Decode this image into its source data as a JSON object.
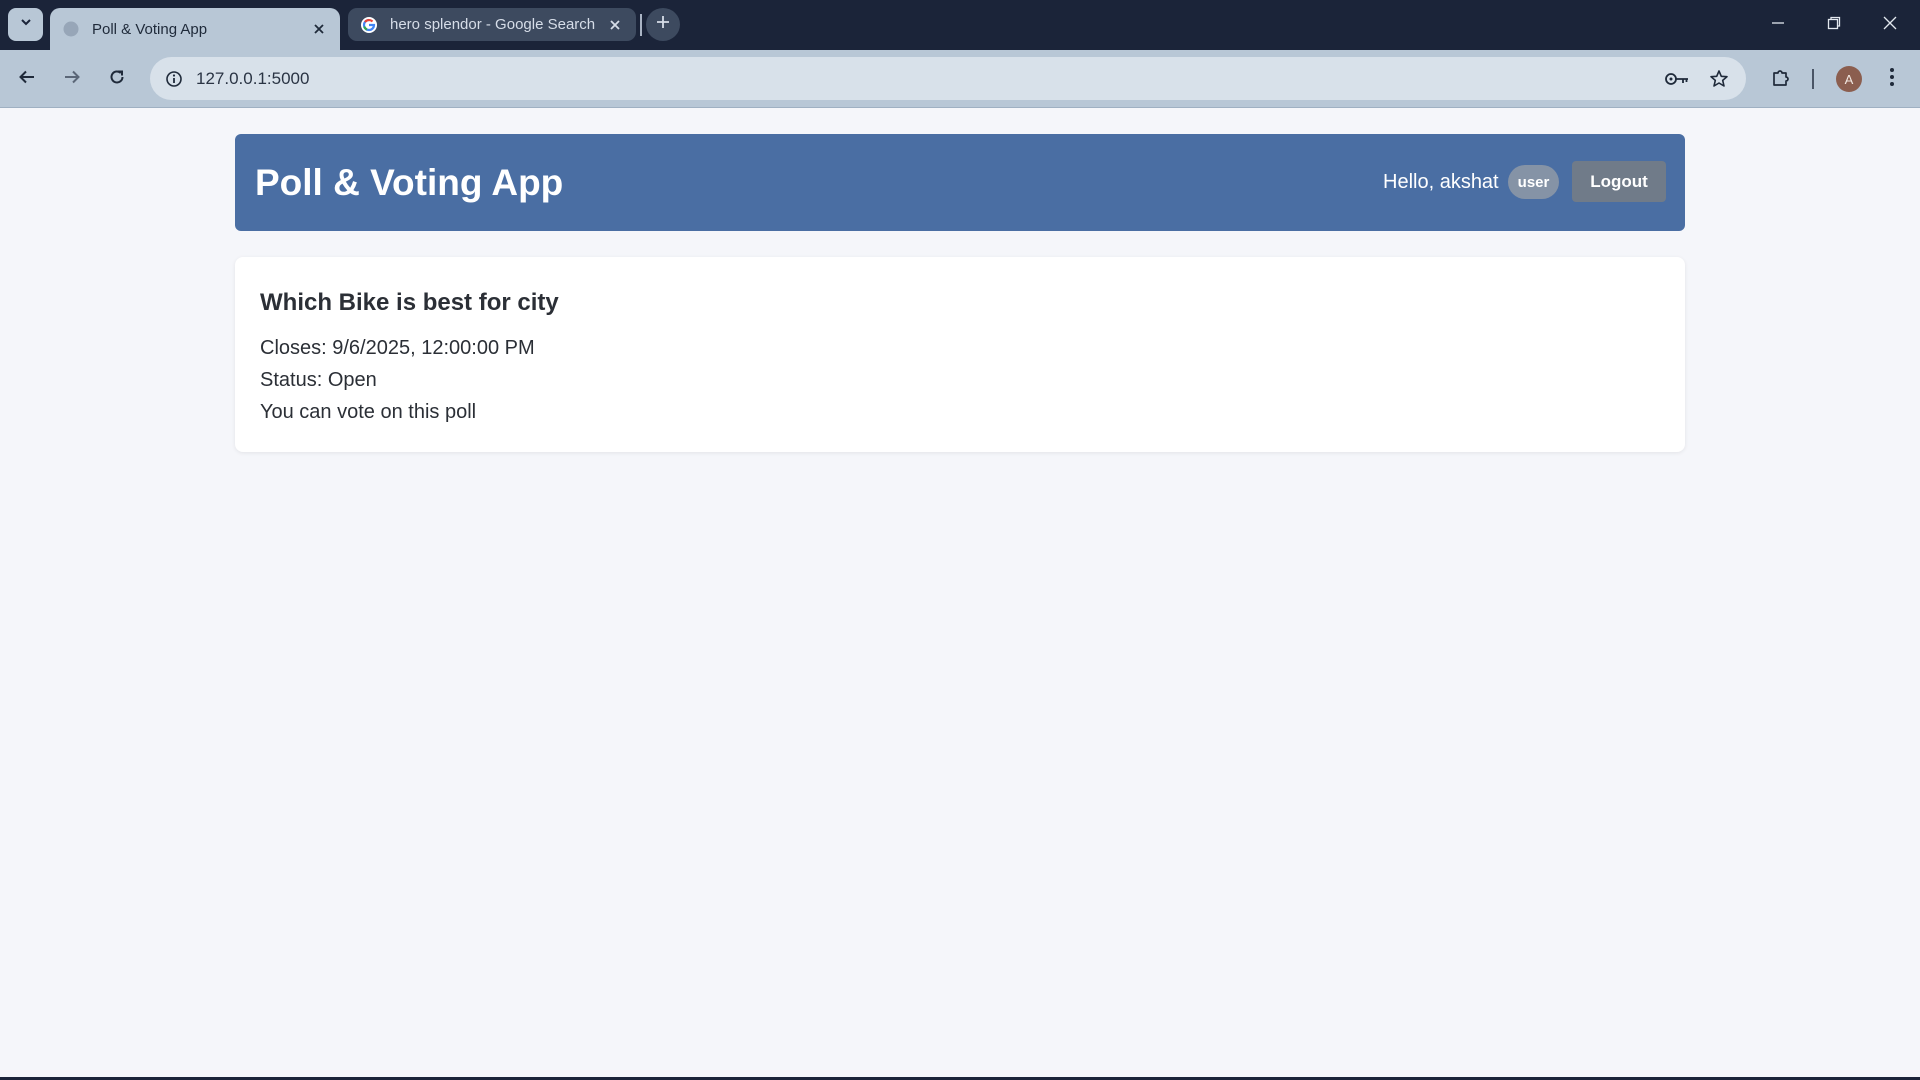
{
  "browser": {
    "tabs": [
      {
        "title": "Poll & Voting App",
        "active": true
      },
      {
        "title": "hero splendor - Google Search",
        "active": false
      }
    ],
    "address_bar": {
      "url": "127.0.0.1:5000"
    },
    "profile_initial": "A",
    "colors": {
      "tabstrip": "#1b2439",
      "toolbar": "#b8c7d6"
    }
  },
  "app": {
    "header": {
      "title": "Poll & Voting App",
      "greeting": "Hello, akshat",
      "role_badge": "user",
      "logout_label": "Logout",
      "color": "#4a6ea3"
    },
    "poll": {
      "question": "Which Bike is best for city",
      "closes": "Closes: 9/6/2025, 12:00:00 PM",
      "status": "Status: Open",
      "vote_note": "You can vote on this poll"
    }
  }
}
